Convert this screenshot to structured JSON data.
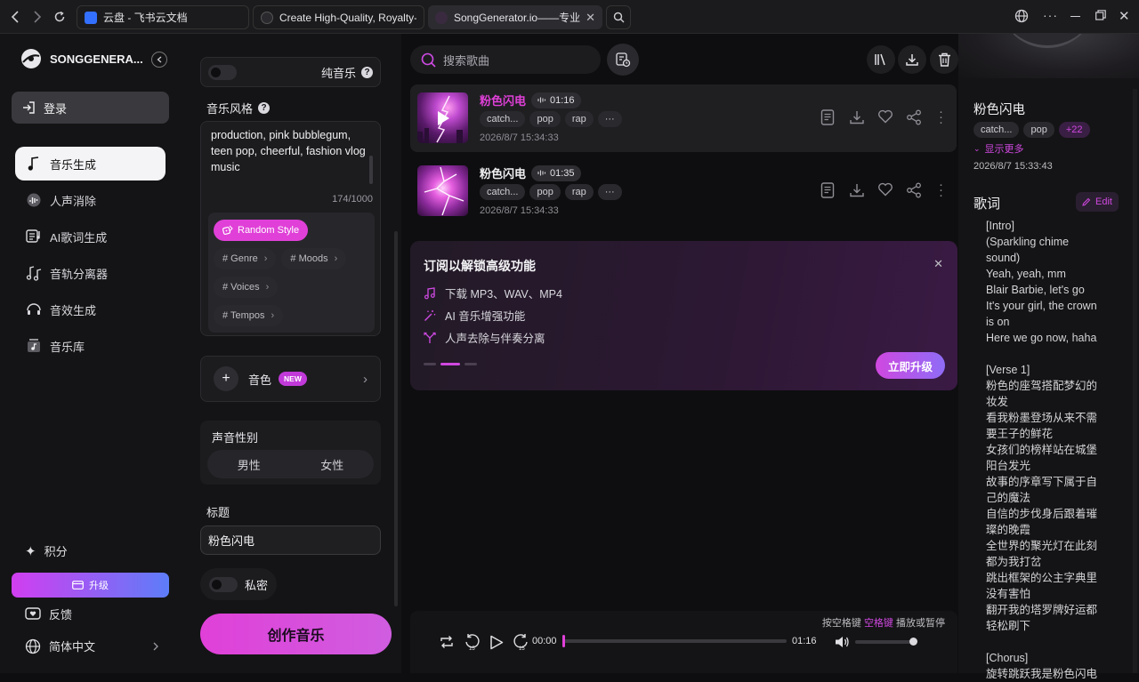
{
  "browser": {
    "tabs": [
      {
        "title": "云盘 - 飞书云文档",
        "active": false
      },
      {
        "title": "Create High-Quality, Royalty-Fre",
        "active": false
      },
      {
        "title": "SongGenerator.io——专业的",
        "active": true
      }
    ]
  },
  "sidebar": {
    "brand": "SONGGENERA...",
    "login": "登录",
    "items": [
      {
        "label": "音乐生成",
        "icon": "music-note-icon",
        "active": true
      },
      {
        "label": "人声消除",
        "icon": "vocal-remove-icon",
        "active": false
      },
      {
        "label": "AI歌词生成",
        "icon": "lyrics-icon",
        "active": false
      },
      {
        "label": "音轨分离器",
        "icon": "stem-split-icon",
        "active": false
      },
      {
        "label": "音效生成",
        "icon": "sound-effect-icon",
        "active": false
      },
      {
        "label": "音乐库",
        "icon": "library-icon",
        "active": false
      }
    ],
    "points": "积分",
    "upgrade": "升级",
    "feedback": "反馈",
    "language": "简体中文"
  },
  "form": {
    "instrumental_label": "纯音乐",
    "style_label": "音乐风格",
    "style_text": "production, pink bubblegum, teen pop, cheerful, fashion vlog music",
    "char_count": "174/1000",
    "random_style": "Random Style",
    "chips": [
      "# Genre",
      "# Moods",
      "# Voices",
      "# Tempos"
    ],
    "voice_label": "音色",
    "new_badge": "NEW",
    "gender_label": "声音性别",
    "gender_options": [
      "男性",
      "女性"
    ],
    "title_label": "标题",
    "title_value": "粉色闪电",
    "private_label": "私密",
    "create_button": "创作音乐"
  },
  "toolbar": {
    "search_placeholder": "搜索歌曲"
  },
  "songs": [
    {
      "title": "粉色闪电",
      "duration": "01:16",
      "tags": [
        "catch...",
        "pop",
        "rap",
        "···"
      ],
      "date": "2026/8/7 15:34:33",
      "selected": true
    },
    {
      "title": "粉色闪电",
      "duration": "01:35",
      "tags": [
        "catch...",
        "pop",
        "rap",
        "···"
      ],
      "date": "2026/8/7 15:34:33",
      "selected": false
    }
  ],
  "promo": {
    "title": "订阅以解锁高级功能",
    "features": [
      "下载 MP3、WAV、MP4",
      "AI 音乐增强功能",
      "人声去除与伴奏分离"
    ],
    "button": "立即升级"
  },
  "player": {
    "hint_prefix": "按空格键",
    "hint_key": "空格键",
    "hint_suffix": "播放或暂停",
    "current": "00:00",
    "total": "01:16",
    "progress": 0.0,
    "volume": 0.95
  },
  "detail": {
    "title": "粉色闪电",
    "tags": [
      "catch...",
      "pop"
    ],
    "more_tags": "+22",
    "show_more": "显示更多",
    "date": "2026/8/7 15:33:43",
    "lyrics_heading": "歌词",
    "edit": "Edit",
    "lyrics": [
      "[Intro]",
      "(Sparkling chime sound)",
      "Yeah, yeah, mm",
      "Blair Barbie, let's go",
      "It's your girl, the crown is on",
      "Here we go now, haha",
      "",
      "[Verse 1]",
      "粉色的座驾搭配梦幻的妆发",
      "看我粉墨登场从来不需要王子的鲜花",
      "女孩们的榜样站在城堡阳台发光",
      "故事的序章写下属于自己的魔法",
      "自信的步伐身后跟着璀璨的晚霞",
      "全世界的聚光灯在此刻都为我打岔",
      "跳出框架的公主字典里没有害怕",
      "翻开我的塔罗牌好运都轻松刷下",
      "",
      "[Chorus]",
      "旋转跳跃我是粉色闪电"
    ]
  },
  "colors": {
    "accent": "#e040d8",
    "accent2": "#b04dff",
    "upgrade_grad_start": "#d13ef0",
    "upgrade_grad_end": "#5d7df8"
  }
}
